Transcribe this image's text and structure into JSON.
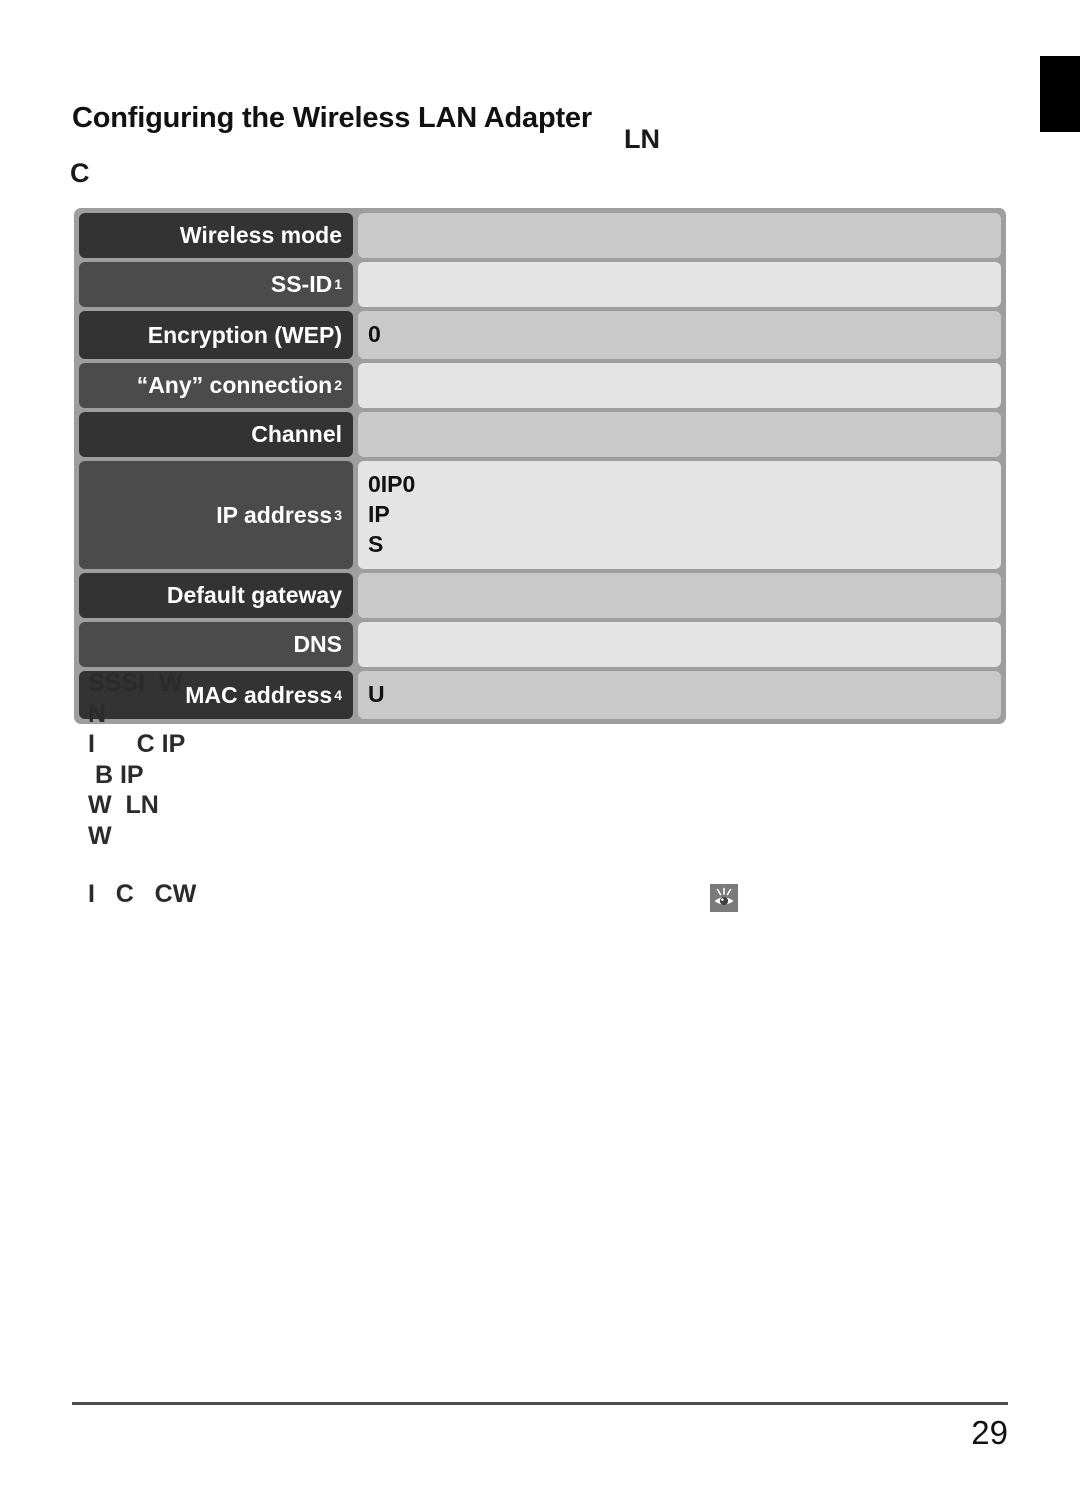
{
  "document": {
    "page_title": "Configuring the Wireless LAN Adapter",
    "intro_fragment_a": "LN",
    "intro_fragment_b": "C",
    "page_number": "29"
  },
  "settings_table": {
    "rows": [
      {
        "label": "Wireless mode",
        "superscript": "",
        "value_lines": [
          ""
        ],
        "tone": "dark"
      },
      {
        "label": "SS-ID",
        "superscript": "1",
        "value_lines": [
          ""
        ],
        "tone": "mid"
      },
      {
        "label": "Encryption (WEP)",
        "superscript": "",
        "value_lines": [
          "0"
        ],
        "tone": "dark"
      },
      {
        "label": "“Any” connection",
        "superscript": "2",
        "value_lines": [
          ""
        ],
        "tone": "mid"
      },
      {
        "label": "Channel",
        "superscript": "",
        "value_lines": [
          ""
        ],
        "tone": "dark"
      },
      {
        "label": "IP address",
        "superscript": "3",
        "value_lines": [
          "0IP0",
          "IP",
          "S"
        ],
        "tone": "mid"
      },
      {
        "label": "Default gateway",
        "superscript": "",
        "value_lines": [
          ""
        ],
        "tone": "dark"
      },
      {
        "label": "DNS",
        "superscript": "",
        "value_lines": [
          ""
        ],
        "tone": "mid"
      },
      {
        "label": "MAC address",
        "superscript": "4",
        "value_lines": [
          "U"
        ],
        "tone": "dark"
      }
    ]
  },
  "footnotes": {
    "lines": [
      "SSSI  W",
      "N",
      "I      C IP",
      " B IP",
      "W  LN",
      "W"
    ]
  },
  "note": {
    "text": "I   C   CW",
    "icon": "eye-icon"
  }
}
